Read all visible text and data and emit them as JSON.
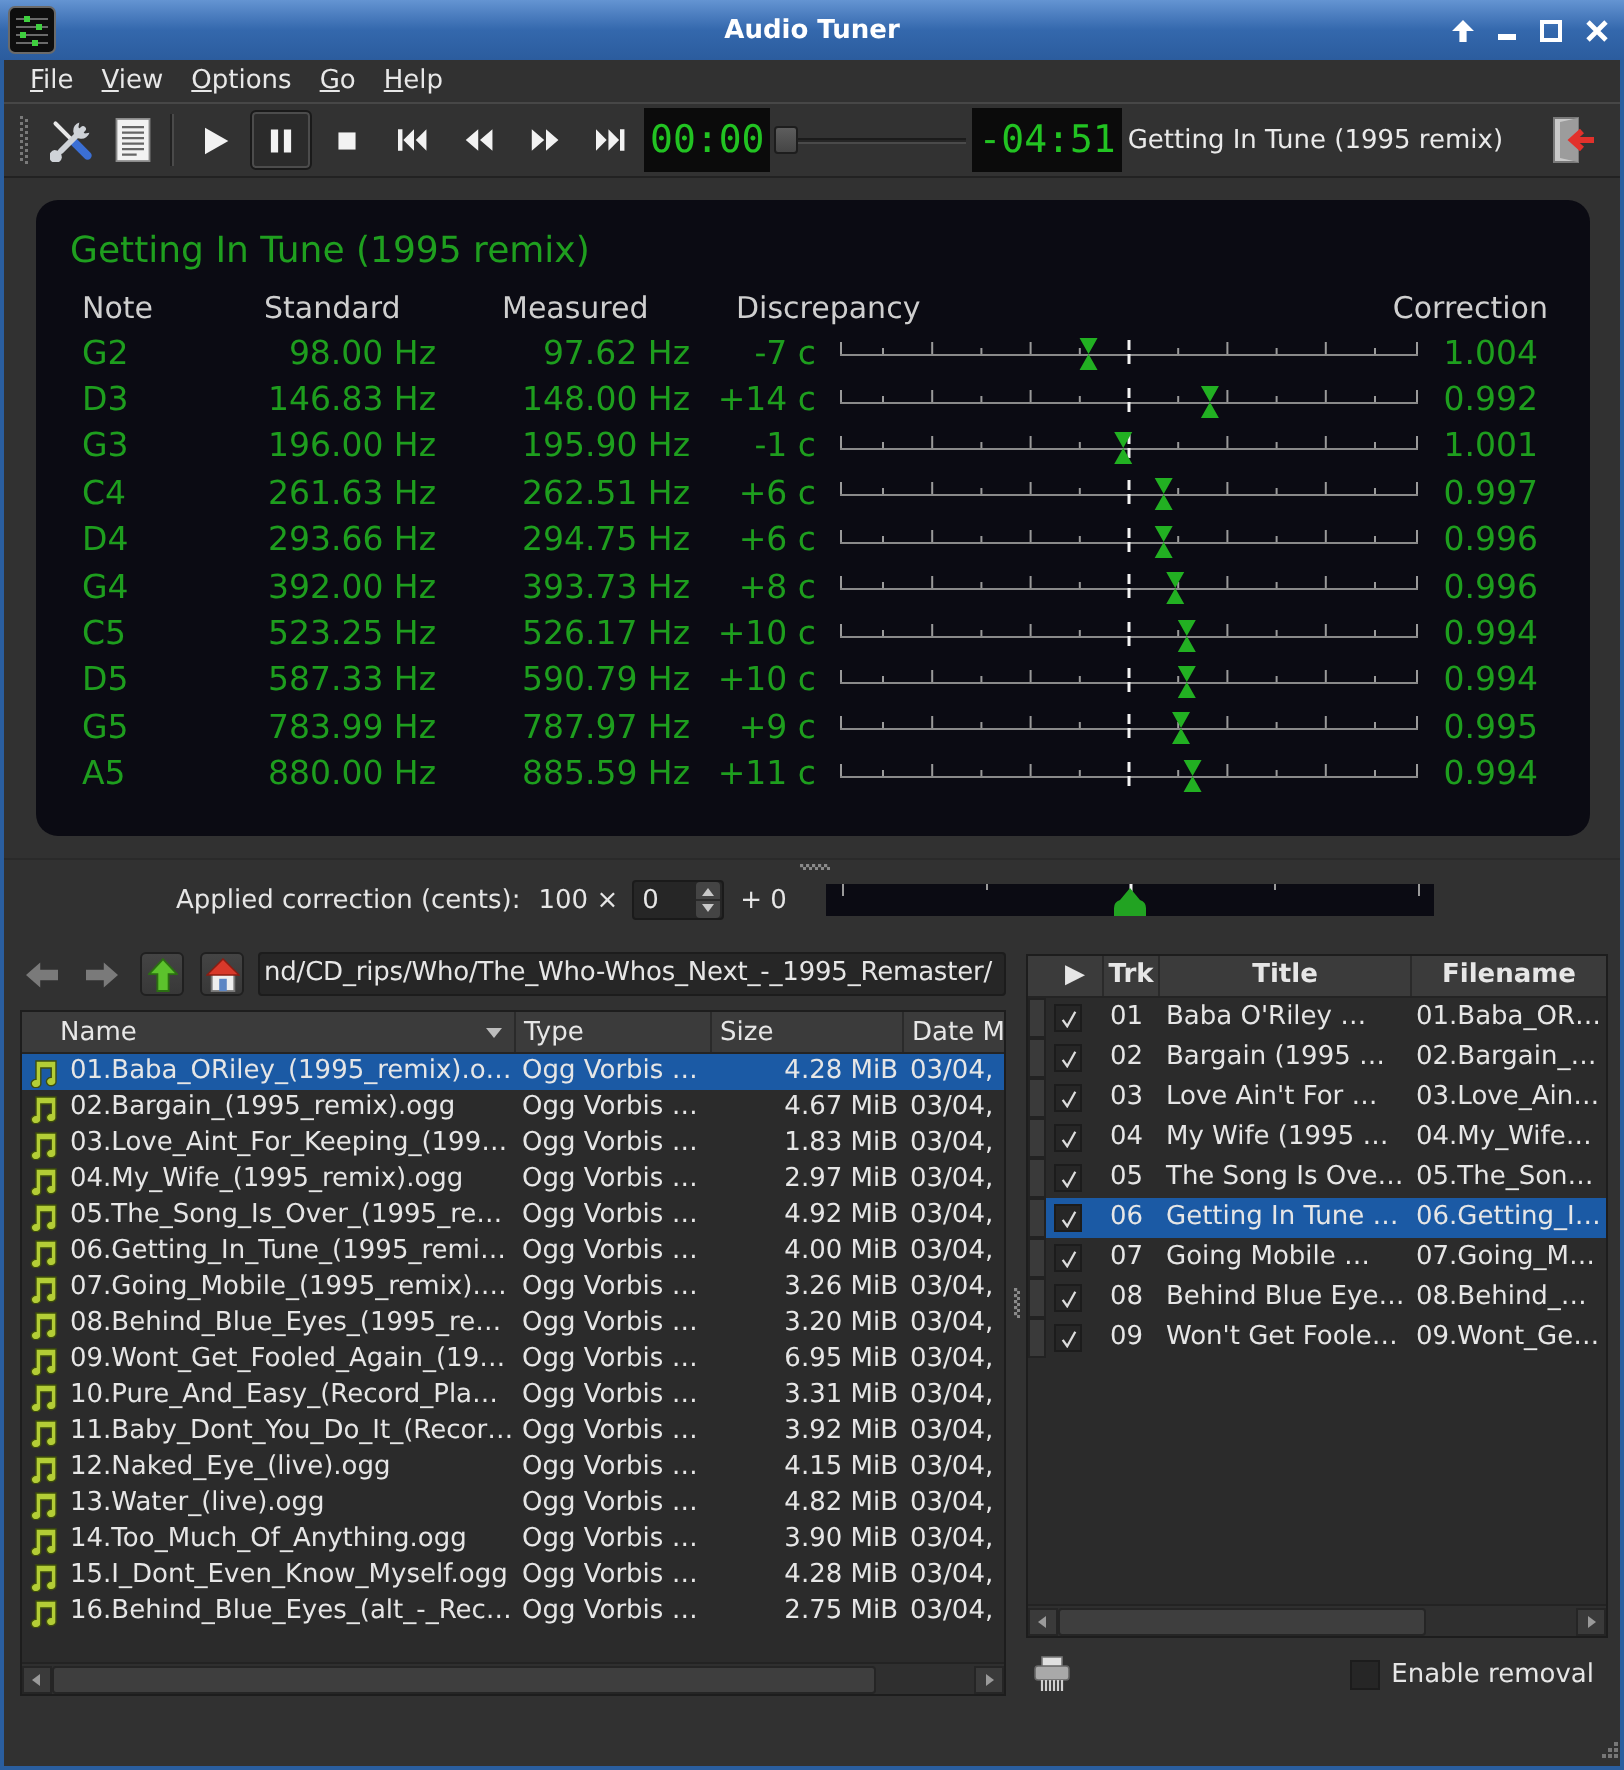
{
  "window": {
    "title": "Audio Tuner"
  },
  "menu": [
    "File",
    "View",
    "Options",
    "Go",
    "Help"
  ],
  "toolbar": {
    "transport": [
      {
        "kind": "play",
        "pressed": false
      },
      {
        "kind": "pause",
        "pressed": true
      },
      {
        "kind": "stop",
        "pressed": false
      },
      {
        "kind": "prev",
        "pressed": false
      },
      {
        "kind": "rewind",
        "pressed": false
      },
      {
        "kind": "forward",
        "pressed": false
      },
      {
        "kind": "next",
        "pressed": false
      }
    ],
    "elapsed": "00:00",
    "position": {
      "level": 0
    },
    "remaining": "-04:51",
    "now_playing": "Getting In Tune (1995 remix)"
  },
  "tuner": {
    "title": "Getting In Tune (1995 remix)",
    "columns": [
      "Note",
      "Standard",
      "Measured",
      "Discrepancy",
      "Correction"
    ],
    "rows": [
      {
        "note": "G2",
        "standard": "98.00 Hz",
        "measured": "97.62 Hz",
        "discrepancy": "-7 c",
        "level": 0.43,
        "correction": "1.004"
      },
      {
        "note": "D3",
        "standard": "146.83 Hz",
        "measured": "148.00 Hz",
        "discrepancy": "+14 c",
        "level": 0.64,
        "correction": "0.992"
      },
      {
        "note": "G3",
        "standard": "196.00 Hz",
        "measured": "195.90 Hz",
        "discrepancy": "-1 c",
        "level": 0.49,
        "correction": "1.001"
      },
      {
        "note": "C4",
        "standard": "261.63 Hz",
        "measured": "262.51 Hz",
        "discrepancy": "+6 c",
        "level": 0.56,
        "correction": "0.997"
      },
      {
        "note": "D4",
        "standard": "293.66 Hz",
        "measured": "294.75 Hz",
        "discrepancy": "+6 c",
        "level": 0.56,
        "correction": "0.996"
      },
      {
        "note": "G4",
        "standard": "392.00 Hz",
        "measured": "393.73 Hz",
        "discrepancy": "+8 c",
        "level": 0.58,
        "correction": "0.996"
      },
      {
        "note": "C5",
        "standard": "523.25 Hz",
        "measured": "526.17 Hz",
        "discrepancy": "+10 c",
        "level": 0.6,
        "correction": "0.994"
      },
      {
        "note": "D5",
        "standard": "587.33 Hz",
        "measured": "590.79 Hz",
        "discrepancy": "+10 c",
        "level": 0.6,
        "correction": "0.994"
      },
      {
        "note": "G5",
        "standard": "783.99 Hz",
        "measured": "787.97 Hz",
        "discrepancy": "+9 c",
        "level": 0.59,
        "correction": "0.995"
      },
      {
        "note": "A5",
        "standard": "880.00 Hz",
        "measured": "885.59 Hz",
        "discrepancy": "+11 c",
        "level": 0.61,
        "correction": "0.994"
      }
    ]
  },
  "applied_correction": {
    "label": "Applied correction (cents):",
    "multiplier": "100 ×",
    "value": "0",
    "offset": "+ 0",
    "level": 0.5
  },
  "file_browser": {
    "nav": [
      {
        "kind": "back",
        "disabled": true
      },
      {
        "kind": "forward",
        "disabled": true
      },
      {
        "kind": "up",
        "disabled": false
      },
      {
        "kind": "home",
        "disabled": false
      }
    ],
    "path": "nd/CD_rips/Who/The_Who-Whos_Next_-_1995_Remaster/",
    "columns": [
      {
        "label": "Name",
        "sorted": true
      },
      {
        "label": "Type",
        "sorted": false
      },
      {
        "label": "Size",
        "sorted": false
      },
      {
        "label": "Date M",
        "sorted": false
      }
    ],
    "rows": [
      {
        "name": "01.Baba_ORiley_(1995_remix).o…",
        "type": "Ogg Vorbis …",
        "size": "4.28 MiB",
        "date": "03/04,",
        "selected": true
      },
      {
        "name": "02.Bargain_(1995_remix).ogg",
        "type": "Ogg Vorbis …",
        "size": "4.67 MiB",
        "date": "03/04,",
        "selected": false
      },
      {
        "name": "03.Love_Aint_For_Keeping_(199…",
        "type": "Ogg Vorbis …",
        "size": "1.83 MiB",
        "date": "03/04,",
        "selected": false
      },
      {
        "name": "04.My_Wife_(1995_remix).ogg",
        "type": "Ogg Vorbis …",
        "size": "2.97 MiB",
        "date": "03/04,",
        "selected": false
      },
      {
        "name": "05.The_Song_Is_Over_(1995_re…",
        "type": "Ogg Vorbis …",
        "size": "4.92 MiB",
        "date": "03/04,",
        "selected": false
      },
      {
        "name": "06.Getting_In_Tune_(1995_remi…",
        "type": "Ogg Vorbis …",
        "size": "4.00 MiB",
        "date": "03/04,",
        "selected": false
      },
      {
        "name": "07.Going_Mobile_(1995_remix).…",
        "type": "Ogg Vorbis …",
        "size": "3.26 MiB",
        "date": "03/04,",
        "selected": false
      },
      {
        "name": "08.Behind_Blue_Eyes_(1995_re…",
        "type": "Ogg Vorbis …",
        "size": "3.20 MiB",
        "date": "03/04,",
        "selected": false
      },
      {
        "name": "09.Wont_Get_Fooled_Again_(19…",
        "type": "Ogg Vorbis …",
        "size": "6.95 MiB",
        "date": "03/04,",
        "selected": false
      },
      {
        "name": "10.Pure_And_Easy_(Record_Pla…",
        "type": "Ogg Vorbis …",
        "size": "3.31 MiB",
        "date": "03/04,",
        "selected": false
      },
      {
        "name": "11.Baby_Dont_You_Do_It_(Recor…",
        "type": "Ogg Vorbis …",
        "size": "3.92 MiB",
        "date": "03/04,",
        "selected": false
      },
      {
        "name": "12.Naked_Eye_(live).ogg",
        "type": "Ogg Vorbis …",
        "size": "4.15 MiB",
        "date": "03/04,",
        "selected": false
      },
      {
        "name": "13.Water_(live).ogg",
        "type": "Ogg Vorbis …",
        "size": "4.82 MiB",
        "date": "03/04,",
        "selected": false
      },
      {
        "name": "14.Too_Much_Of_Anything.ogg",
        "type": "Ogg Vorbis …",
        "size": "3.90 MiB",
        "date": "03/04,",
        "selected": false
      },
      {
        "name": "15.I_Dont_Even_Know_Myself.ogg",
        "type": "Ogg Vorbis …",
        "size": "4.28 MiB",
        "date": "03/04,",
        "selected": false
      },
      {
        "name": "16.Behind_Blue_Eyes_(alt_-_Rec…",
        "type": "Ogg Vorbis …",
        "size": "2.75 MiB",
        "date": "03/04,",
        "selected": false
      }
    ]
  },
  "playlist": {
    "columns": [
      "▶",
      "Trk",
      "Title",
      "Filename"
    ],
    "rows": [
      {
        "checked": true,
        "track": "01",
        "title": "Baba O'Riley …",
        "filename": "01.Baba_OR…",
        "selected": false
      },
      {
        "checked": true,
        "track": "02",
        "title": "Bargain (1995 …",
        "filename": "02.Bargain_…",
        "selected": false
      },
      {
        "checked": true,
        "track": "03",
        "title": "Love Ain't For …",
        "filename": "03.Love_Ain…",
        "selected": false
      },
      {
        "checked": true,
        "track": "04",
        "title": "My Wife (1995 …",
        "filename": "04.My_Wife…",
        "selected": false
      },
      {
        "checked": true,
        "track": "05",
        "title": "The Song Is Ove…",
        "filename": "05.The_Son…",
        "selected": false
      },
      {
        "checked": true,
        "track": "06",
        "title": "Getting In Tune …",
        "filename": "06.Getting_I…",
        "selected": true
      },
      {
        "checked": true,
        "track": "07",
        "title": "Going Mobile …",
        "filename": "07.Going_M…",
        "selected": false
      },
      {
        "checked": true,
        "track": "08",
        "title": "Behind Blue Eye…",
        "filename": "08.Behind_…",
        "selected": false
      },
      {
        "checked": true,
        "track": "09",
        "title": "Won't Get Foole…",
        "filename": "09.Wont_Ge…",
        "selected": false
      }
    ]
  },
  "enable_removal": {
    "label": "Enable removal",
    "checked": false
  }
}
